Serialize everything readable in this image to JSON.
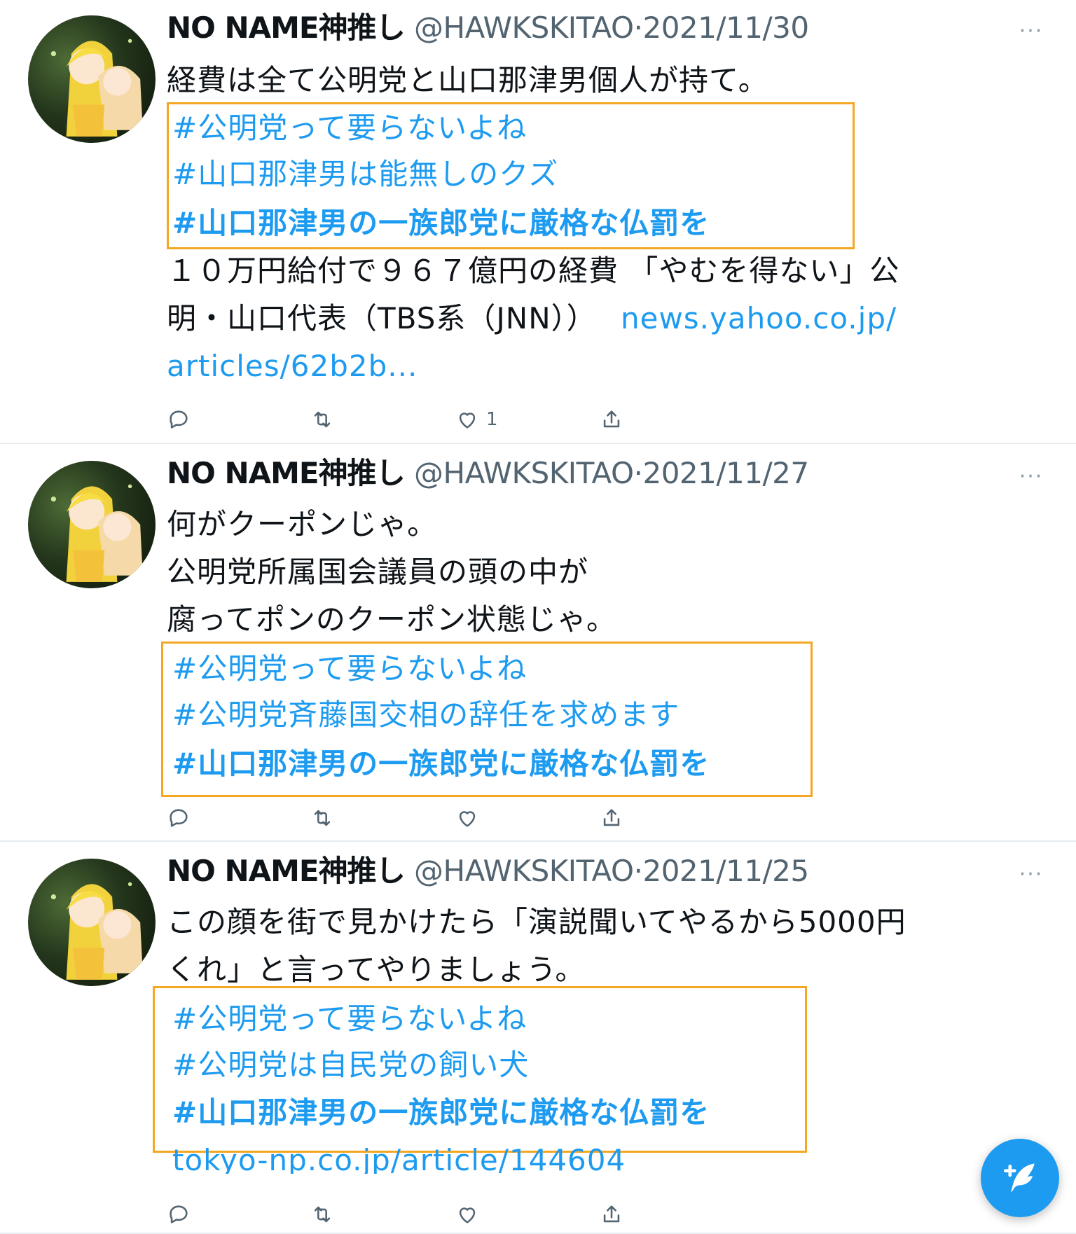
{
  "tweets": [
    {
      "name": "NO NAME神推し",
      "handle": "@HAWKSKITAO",
      "sep": "·",
      "date": "2021/11/30",
      "more": "···",
      "body_top": [
        "経費は全て公明党と山口那津男個人が持て。"
      ],
      "hashtags": [
        "#公明党って要らないよね",
        "#山口那津男は能無しのクズ",
        "#山口那津男の一族郎党に厳格な仏罰を"
      ],
      "body_bottom": [
        {
          "text": "１０万円給付で９６７億円の経費 「やむを得ない」公",
          "link": ""
        },
        {
          "text": "明・山口代表（TBS系（JNN））",
          "link": "news.yahoo.co.jp/"
        },
        {
          "text": "",
          "link": "articles/62b2b..."
        }
      ],
      "likes": "1"
    },
    {
      "name": "NO NAME神推し",
      "handle": "@HAWKSKITAO",
      "sep": "·",
      "date": "2021/11/27",
      "more": "···",
      "body_top": [
        "何がクーポンじゃ。",
        "公明党所属国会議員の頭の中が",
        "腐ってポンのクーポン状態じゃ。"
      ],
      "hashtags": [
        "#公明党って要らないよね",
        "#公明党斉藤国交相の辞任を求めます",
        "#山口那津男の一族郎党に厳格な仏罰を"
      ],
      "body_bottom": [],
      "likes": ""
    },
    {
      "name": "NO NAME神推し",
      "handle": "@HAWKSKITAO",
      "sep": "·",
      "date": "2021/11/25",
      "more": "···",
      "body_top": [
        "この顔を街で見かけたら「演説聞いてやるから5000円",
        "くれ」と言ってやりましょう。"
      ],
      "hashtags": [
        "#公明党って要らないよね",
        "#公明党は自民党の飼い犬",
        "#山口那津男の一族郎党に厳格な仏罰を"
      ],
      "body_bottom": [
        {
          "text": "",
          "link": "tokyo-np.co.jp/article/144604"
        }
      ],
      "likes": ""
    }
  ],
  "icons": {
    "reply": "reply-icon",
    "retweet": "retweet-icon",
    "like": "like-icon",
    "share": "share-icon",
    "compose": "compose-tweet-icon"
  },
  "colors": {
    "link": "#1d9bf0",
    "highlight_box": "#f5a623",
    "muted": "#536471"
  }
}
